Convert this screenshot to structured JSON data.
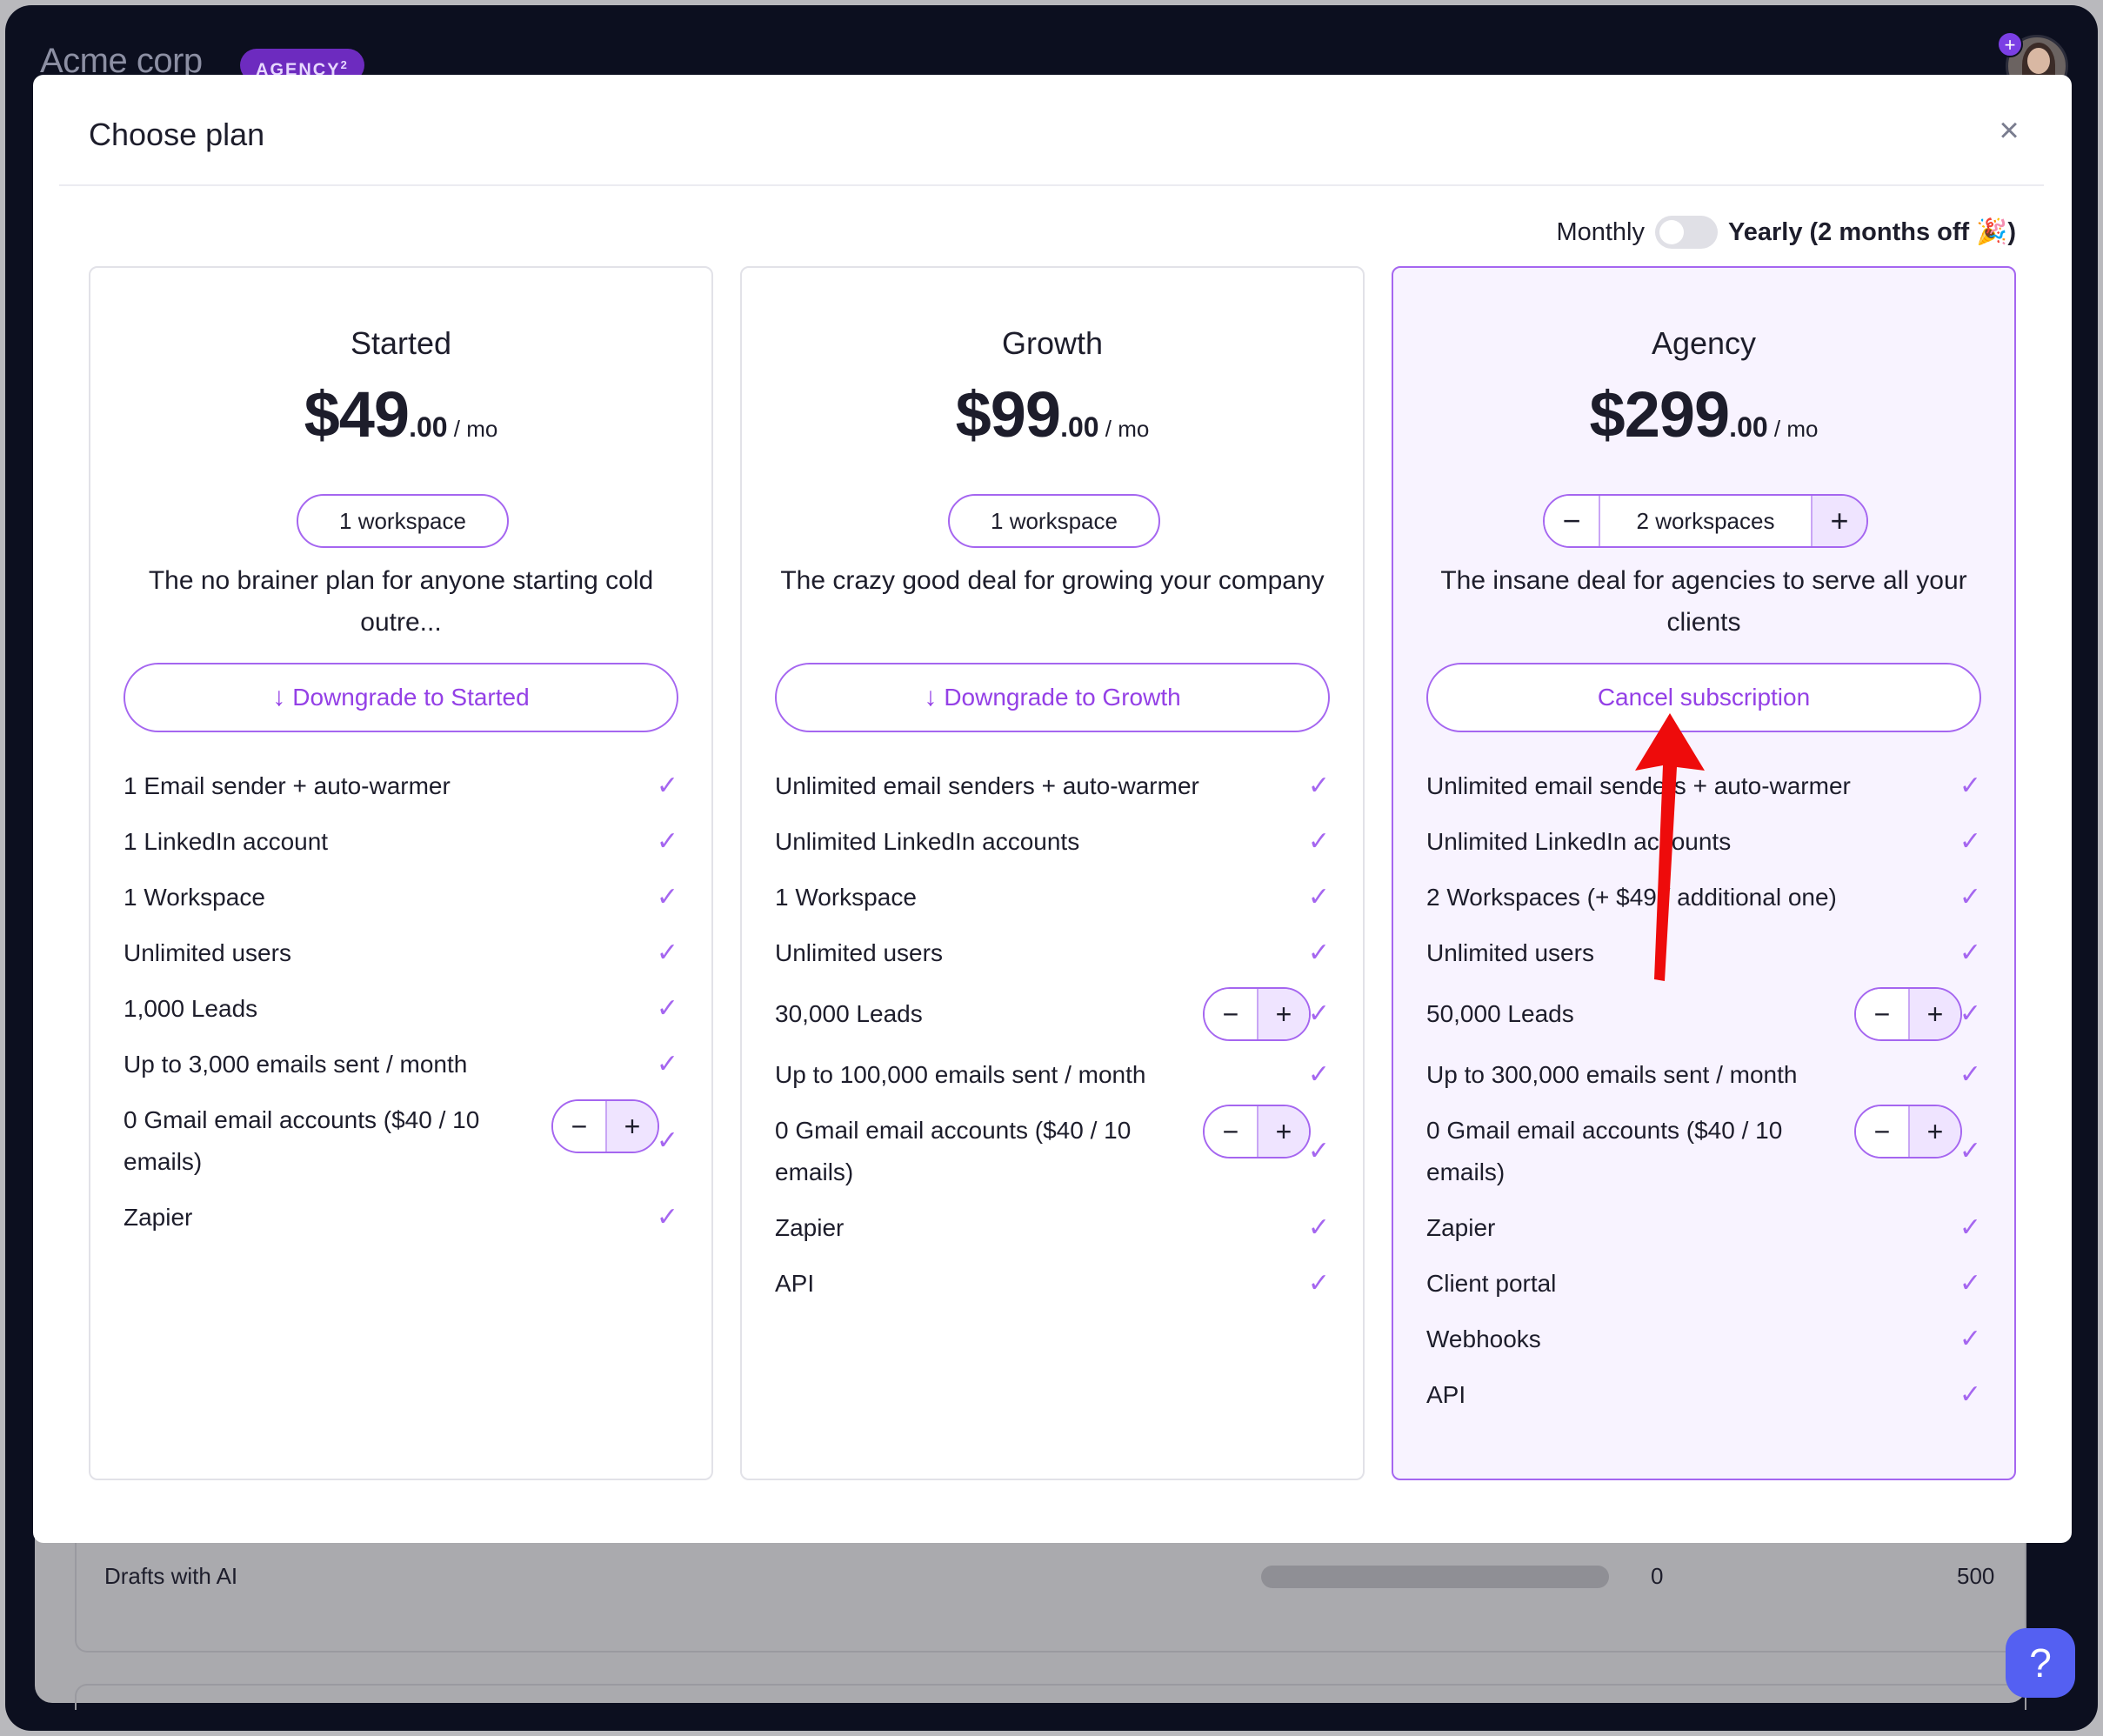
{
  "topbar": {
    "title": "Acme corp",
    "badge": "AGENCY",
    "badge_sup": "2",
    "avatar_plus": "+"
  },
  "background": {
    "drafts_label": "Drafts with AI",
    "drafts_count": "0",
    "drafts_limit": "500",
    "help": "?"
  },
  "modal": {
    "title": "Choose plan",
    "close": "×",
    "toggle": {
      "off_label": "Monthly",
      "on_label": "Yearly (2 months off 🎉)"
    }
  },
  "plans": [
    {
      "name": "Started",
      "price": "$49",
      "cents": ".00",
      "unit": " / mo",
      "workspaces": "1 workspace",
      "description": "The no brainer plan for anyone starting cold outre...",
      "action": "Downgrade to Started",
      "action_icon": "↓",
      "features": [
        "1 Email sender + auto-warmer",
        "1 LinkedIn account",
        "1 Workspace",
        "Unlimited users",
        "1,000 Leads",
        "Up to 3,000 emails sent / month",
        "0 Gmail email accounts ($40 / 10 emails)",
        "Zapier"
      ]
    },
    {
      "name": "Growth",
      "price": "$99",
      "cents": ".00",
      "unit": " / mo",
      "workspaces": "1 workspace",
      "description": "The crazy good deal for growing your company",
      "action": "Downgrade to Growth",
      "action_icon": "↓",
      "features": [
        "Unlimited email senders + auto-warmer",
        "Unlimited LinkedIn accounts",
        "1 Workspace",
        "Unlimited users",
        "30,000 Leads",
        "Up to 100,000 emails sent / month",
        "0 Gmail email accounts ($40 / 10 emails)",
        "Zapier",
        "API"
      ]
    },
    {
      "name": "Agency",
      "price": "$299",
      "cents": ".00",
      "unit": " / mo",
      "workspaces": "2 workspaces",
      "description": "The insane deal for agencies to serve all your clients",
      "action": "Cancel subscription",
      "features": [
        "Unlimited email senders + auto-warmer",
        "Unlimited LinkedIn accounts",
        "2 Workspaces (+ $49 / additional one)",
        "Unlimited users",
        "50,000 Leads",
        "Up to 300,000 emails sent / month",
        "0 Gmail email accounts ($40 / 10 emails)",
        "Zapier",
        "Client portal",
        "Webhooks",
        "API"
      ]
    }
  ],
  "icons": {
    "check": "✓",
    "minus": "−",
    "plus": "+"
  },
  "colors": {
    "accent": "#a566f0",
    "accent_text": "#9440e6",
    "annotation_arrow": "#ee0b0b",
    "help_button": "#5460f2"
  }
}
